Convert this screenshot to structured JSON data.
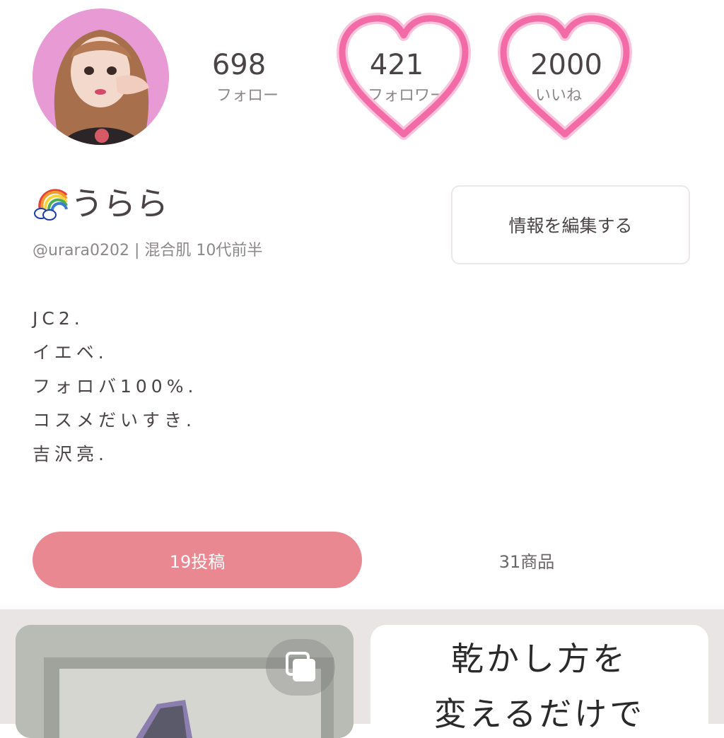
{
  "profile": {
    "name": "うらら",
    "sub_line": "@urara0202 | 混合肌 10代前半",
    "edit_button": "情報を編集する",
    "avatar_icon": "avatar-photo",
    "name_icon": "rainbow-cloud-icon"
  },
  "stats": [
    {
      "value": "698",
      "label": "フォロー"
    },
    {
      "value": "421",
      "label": "フォロワー"
    },
    {
      "value": "2000",
      "label": "いいね"
    }
  ],
  "bio": [
    "JC2.",
    "イエベ.",
    "フォロバ100%.",
    "コスメだいすき.",
    "吉沢亮."
  ],
  "tabs": {
    "posts": "19投稿",
    "products": "31商品"
  },
  "posts": {
    "right_card_line1": "乾かし方を",
    "right_card_line2": "変えるだけで"
  },
  "colors": {
    "accent_pink": "#ea8892",
    "heart_pink": "#f26aa6",
    "text": "#4a4446",
    "subtext": "#8c8889",
    "grid_bg": "#e9e5e4"
  }
}
